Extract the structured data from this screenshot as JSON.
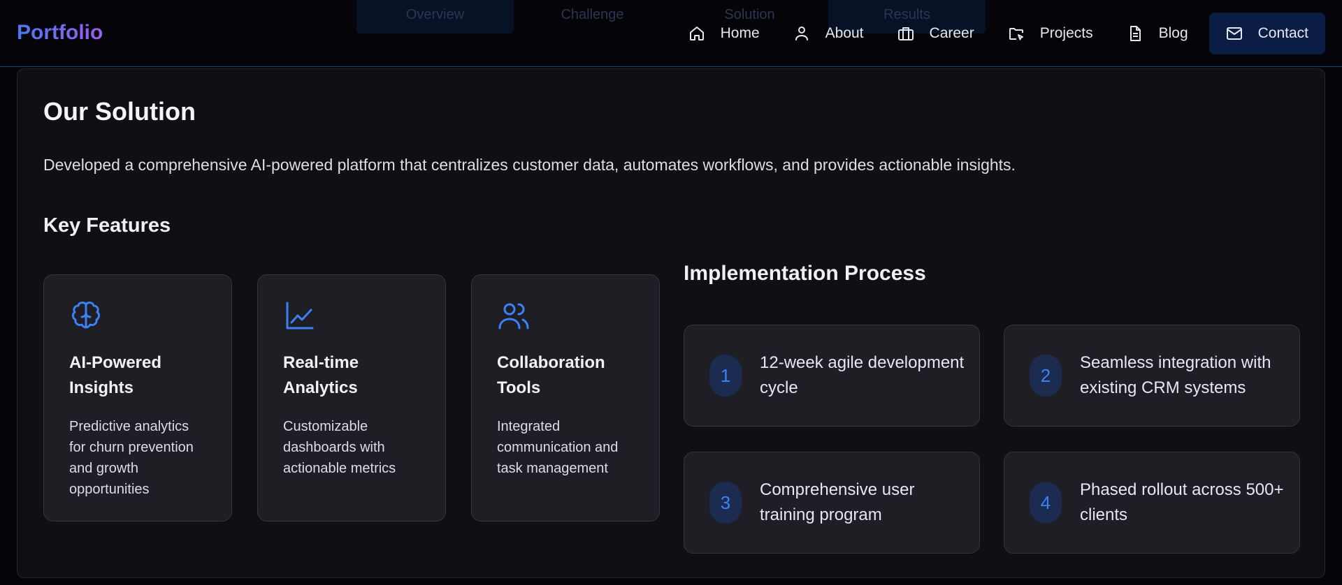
{
  "section_tabs": [
    {
      "label": "Overview"
    },
    {
      "label": "Challenge"
    },
    {
      "label": "Solution"
    },
    {
      "label": "Results"
    }
  ],
  "navbar": {
    "logo": "Portfolio",
    "items": [
      {
        "label": "Home",
        "icon": "home-icon"
      },
      {
        "label": "About",
        "icon": "user-icon"
      },
      {
        "label": "Career",
        "icon": "briefcase-icon"
      },
      {
        "label": "Projects",
        "icon": "folder-icon"
      },
      {
        "label": "Blog",
        "icon": "document-icon"
      },
      {
        "label": "Contact",
        "icon": "mail-icon"
      }
    ]
  },
  "solution": {
    "title": "Our Solution",
    "description": "Developed a comprehensive AI-powered platform that centralizes customer data, automates workflows, and provides actionable insights.",
    "key_features_title": "Key Features",
    "features": [
      {
        "icon": "brain-icon",
        "title": "AI-Powered Insights",
        "description": "Predictive analytics for churn prevention and growth opportunities"
      },
      {
        "icon": "line-chart-icon",
        "title": "Real-time Analytics",
        "description": "Customizable dashboards with actionable metrics"
      },
      {
        "icon": "users-icon",
        "title": "Collaboration Tools",
        "description": "Integrated communication and task management"
      }
    ],
    "implementation_title": "Implementation Process",
    "steps": [
      {
        "number": "1",
        "text": "12-week agile development cycle"
      },
      {
        "number": "2",
        "text": "Seamless integration with existing CRM systems"
      },
      {
        "number": "3",
        "text": "Comprehensive user training program"
      },
      {
        "number": "4",
        "text": "Phased rollout across 500+ clients"
      }
    ]
  },
  "colors": {
    "accent": "#3b82f6",
    "background": "#050509",
    "card": "#1e1e24",
    "nav_border": "#1d3f86"
  }
}
